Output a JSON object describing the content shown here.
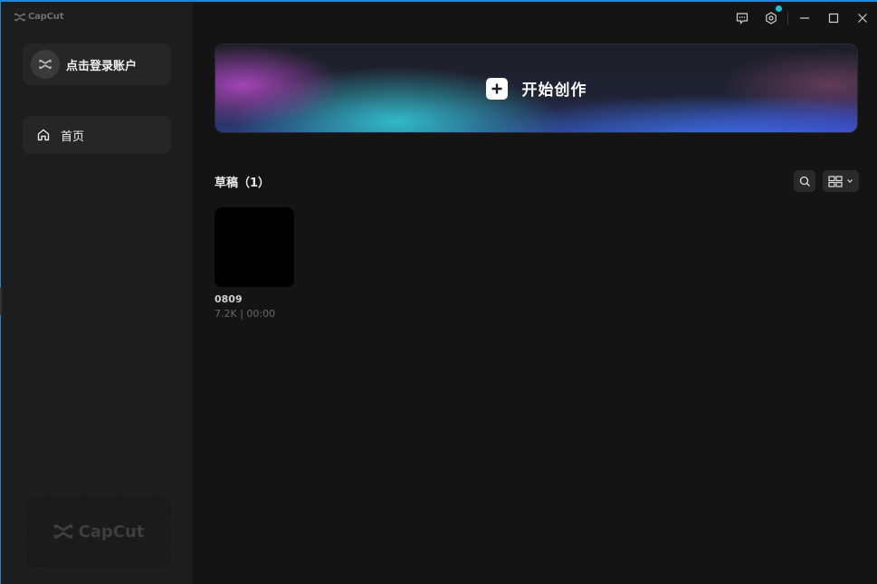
{
  "app": {
    "brand": "CapCut"
  },
  "sidebar": {
    "account_label": "点击登录账户",
    "nav": [
      {
        "label": "首页",
        "icon": "home-icon",
        "active": true
      }
    ],
    "promo_brand": "CapCut"
  },
  "titlebar": {
    "icons": [
      "feedback-icon",
      "settings-icon",
      "minimize-icon",
      "maximize-icon",
      "close-icon"
    ],
    "settings_notification": true
  },
  "banner": {
    "label": "开始创作",
    "icon": "plus-icon"
  },
  "drafts": {
    "title": "草稿（1）",
    "items": [
      {
        "name": "0809",
        "meta": "7.2K | 00:00"
      }
    ]
  },
  "colors": {
    "accent": "#14c2e0",
    "window_border": "#1e88d6",
    "background": "#141414",
    "sidebar": "#1d1d1d"
  }
}
